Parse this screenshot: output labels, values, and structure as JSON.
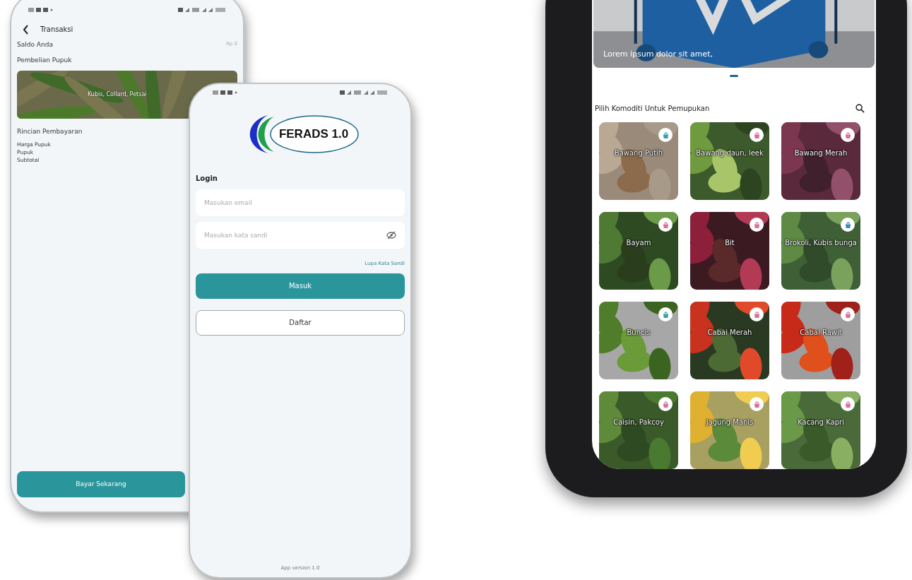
{
  "transaction_screen": {
    "title": "Transaksi",
    "balance_label": "Saldo Anda",
    "balance_value": "Rp 0",
    "section": "Pembelian Pupuk",
    "banner": {
      "kind": "picture",
      "caption": "Kubis, Collard, Petsai"
    },
    "details_title": "Rincian Pembayaran",
    "detail_rows": [
      "Harga Pupuk",
      "Pupuk",
      "Subtotal"
    ],
    "pay_button": "Bayar Sekarang"
  },
  "login_screen": {
    "logo": "FERADS 1.0",
    "title": "Login",
    "email": {
      "placeholder": "Masukan email"
    },
    "password": {
      "placeholder": "Masukan kata sandi"
    },
    "forgot_link": "Lupa Kata Sandi",
    "login_button": "Masuk",
    "register_button": "Daftar",
    "footer": "App version 1.0"
  },
  "home_screen": {
    "banner": {
      "kind": "picture",
      "caption": "Lorem ipsum dolor sit amet,"
    },
    "heading": "Pilih Komoditi Untuk Pemupukan",
    "commodities": [
      {
        "name": "Bawang Putih",
        "color": "#3aa0a8"
      },
      {
        "name": "Bawang daun, leek",
        "color": "#d9709a"
      },
      {
        "name": "Bawang Merah",
        "color": "#d9709a"
      },
      {
        "name": "Bayam",
        "color": "#d9709a"
      },
      {
        "name": "Bit",
        "color": "#d9709a"
      },
      {
        "name": "Brokoli, Kubis bunga",
        "color": "#3a8ab8"
      },
      {
        "name": "Buncis",
        "color": "#3aa0a8"
      },
      {
        "name": "Cabai Merah",
        "color": "#d9709a"
      },
      {
        "name": "Cabai Rawit",
        "color": "#d9709a"
      },
      {
        "name": "Caisin, Pakcoy",
        "color": "#d9709a"
      },
      {
        "name": "Jagung Manis",
        "color": "#d9709a"
      },
      {
        "name": "Kacang Kapri",
        "color": "#d9709a"
      }
    ]
  }
}
